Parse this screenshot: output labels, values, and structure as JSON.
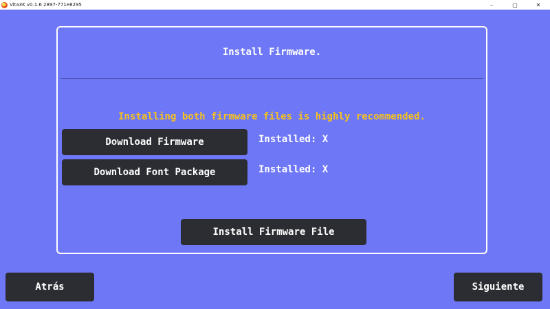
{
  "window": {
    "title": "Vita3K v0.1.6 2897-771e8295",
    "controls": {
      "minimize": "–",
      "maximize": "▢",
      "close": "✕"
    }
  },
  "panel": {
    "title": "Install Firmware.",
    "recommendation": "Installing both firmware files is highly recommended.",
    "firmware": {
      "button_label": "Download Firmware",
      "status": "Installed: X"
    },
    "font_package": {
      "button_label": "Download Font Package",
      "status": "Installed: X"
    },
    "install_button_label": "Install Firmware File"
  },
  "footer": {
    "back_label": "Atrás",
    "next_label": "Siguiente"
  },
  "colors": {
    "background": "#6e78f6",
    "button": "#2b2d33",
    "warning_text": "#f5c11d"
  }
}
